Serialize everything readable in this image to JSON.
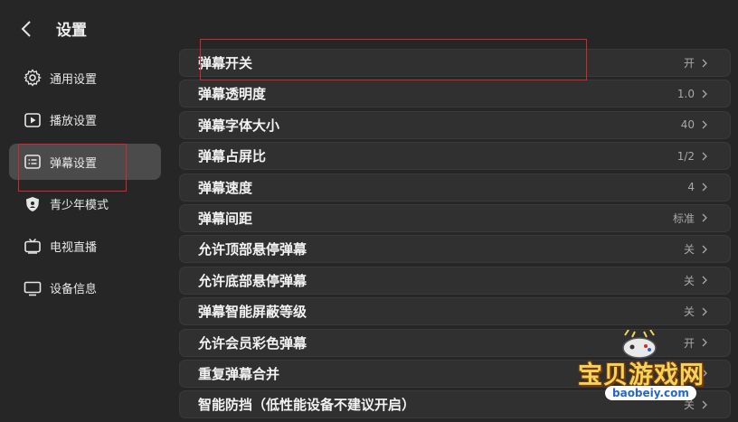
{
  "header": {
    "title": "设置",
    "back_icon": "chevron-left-icon"
  },
  "sidebar": {
    "items": [
      {
        "label": "通用设置",
        "icon": "gear-icon",
        "active": false
      },
      {
        "label": "播放设置",
        "icon": "play-icon",
        "active": false
      },
      {
        "label": "弹幕设置",
        "icon": "danmaku-icon",
        "active": true
      },
      {
        "label": "青少年模式",
        "icon": "shield-icon",
        "active": false
      },
      {
        "label": "电视直播",
        "icon": "tv-antenna-icon",
        "active": false
      },
      {
        "label": "设备信息",
        "icon": "monitor-icon",
        "active": false
      }
    ]
  },
  "settings": [
    {
      "label": "弹幕开关",
      "value": "开"
    },
    {
      "label": "弹幕透明度",
      "value": "1.0"
    },
    {
      "label": "弹幕字体大小",
      "value": "40"
    },
    {
      "label": "弹幕占屏比",
      "value": "1/2"
    },
    {
      "label": "弹幕速度",
      "value": "4"
    },
    {
      "label": "弹幕间距",
      "value": "标准"
    },
    {
      "label": "允许顶部悬停弹幕",
      "value": "关"
    },
    {
      "label": "允许底部悬停弹幕",
      "value": "关"
    },
    {
      "label": "弹幕智能屏蔽等级",
      "value": "关"
    },
    {
      "label": "允许会员彩色弹幕",
      "value": "开"
    },
    {
      "label": "重复弹幕合并",
      "value": ""
    },
    {
      "label": "智能防挡（低性能设备不建议开启）",
      "value": "关"
    }
  ],
  "watermark": {
    "text": "宝贝游戏网",
    "url": "baobeiy.com"
  },
  "colors": {
    "background": "#262626",
    "row": "#303030",
    "active": "#4b4b4b",
    "annotation": "#d9232e",
    "watermark": "#f1d45a"
  }
}
